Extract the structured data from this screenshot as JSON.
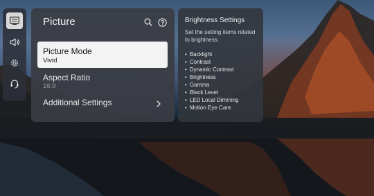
{
  "rail": {
    "items": [
      {
        "icon": "picture-settings-icon",
        "active": true
      },
      {
        "icon": "sound-icon",
        "active": false
      },
      {
        "icon": "gear-icon",
        "active": false
      },
      {
        "icon": "support-headset-icon",
        "active": false
      }
    ]
  },
  "panel": {
    "title": "Picture",
    "icons": [
      "search-icon",
      "help-icon"
    ],
    "items": [
      {
        "label": "Picture Mode",
        "value": "Vivid",
        "selected": true
      },
      {
        "label": "Aspect Ratio",
        "value": "16:9",
        "selected": false
      },
      {
        "label": "Additional Settings",
        "value": "",
        "selected": false,
        "icon": "chevron-right-icon"
      }
    ]
  },
  "info": {
    "title": "Brightness Settings",
    "description": "Set the setting items related to brightness.",
    "items": [
      "Backlight",
      "Contrast",
      "Dynamic Contrast",
      "Brightness",
      "Gamma",
      "Black Level",
      "LED Local Dimming",
      "Motion Eye Care"
    ]
  }
}
